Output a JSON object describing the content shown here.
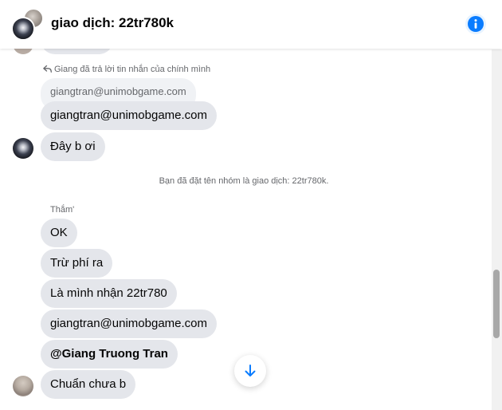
{
  "header": {
    "title": "giao dịch: 22tr780k",
    "info_icon": "info-icon"
  },
  "colors": {
    "accent": "#0a7cff",
    "bubble_bg": "#e4e6eb",
    "quote_bg": "#f0f2f5",
    "muted_text": "#65676b"
  },
  "conversation": {
    "reply_note": "Giang đã trả lời tin nhắn của chính mình",
    "quoted_text": "giangtran@unimobgame.com",
    "reply_text": "giangtran@unimobgame.com",
    "message_day_b_oi": "Đây b ơi",
    "system_message": "Bạn đã đặt tên nhóm là giao dịch: 22tr780k.",
    "sender_name": "Thắm'",
    "messages": [
      {
        "text": "OK"
      },
      {
        "text": "Trừ phí ra"
      },
      {
        "text": "Là mình nhận 22tr780"
      },
      {
        "text": "giangtran@unimobgame.com"
      },
      {
        "text": "@Giang Truong Tran"
      },
      {
        "text": "Chuẩn chưa b"
      }
    ]
  },
  "scroll_down_icon": "arrow-down-icon"
}
